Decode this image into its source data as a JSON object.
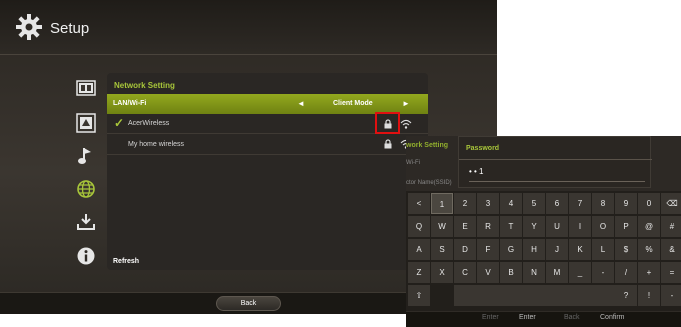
{
  "left_screen": {
    "title": "Setup",
    "categories": [
      {
        "icon": "film-icon"
      },
      {
        "icon": "photo-icon"
      },
      {
        "icon": "music-icon"
      },
      {
        "icon": "globe-icon"
      },
      {
        "icon": "download-icon"
      },
      {
        "icon": "info-icon"
      }
    ],
    "network_panel": {
      "title": "Network Setting",
      "lan_label": "LAN/Wi-Fi",
      "lan_left_arrow": "◄",
      "lan_value": "Client Mode",
      "lan_right_arrow": "►",
      "networks": [
        {
          "name": "AcerWireless",
          "check": "✓",
          "locked": true
        },
        {
          "name": "My home wireless",
          "check": "",
          "locked": true
        }
      ],
      "refresh_label": "Refresh"
    },
    "footer": {
      "back_label": "Back"
    },
    "colors": {
      "accent": "#a8c63a",
      "highlight": "#e01010"
    }
  },
  "right_screen": {
    "bg_panel_title": "work Setting",
    "bg_lan": "Wi-Fi",
    "bg_ssid": "ctor Name(SSID)",
    "password_dialog": {
      "title": "Password",
      "value": "• • 1"
    },
    "keyboard_rows": [
      [
        "<",
        "1",
        "2",
        "3",
        "4",
        "5",
        "6",
        "7",
        "8",
        "9",
        "0",
        "⌫"
      ],
      [
        "Q",
        "W",
        "E",
        "R",
        "T",
        "Y",
        "U",
        "I",
        "O",
        "P",
        "@",
        "#"
      ],
      [
        "A",
        "S",
        "D",
        "F",
        "G",
        "H",
        "J",
        "K",
        "L",
        "$",
        "%",
        "&"
      ],
      [
        "Z",
        "X",
        "C",
        "V",
        "B",
        "N",
        "M",
        "_",
        "-",
        "/",
        "+",
        "="
      ]
    ],
    "keyboard_last_row": {
      "shift": "⇧",
      "space": "",
      "keys": [
        "?",
        "!",
        "-"
      ]
    },
    "footer": {
      "enter_hint": "Enter",
      "enter": "Enter",
      "back_hint": "Back",
      "confirm": "Confirm"
    }
  }
}
